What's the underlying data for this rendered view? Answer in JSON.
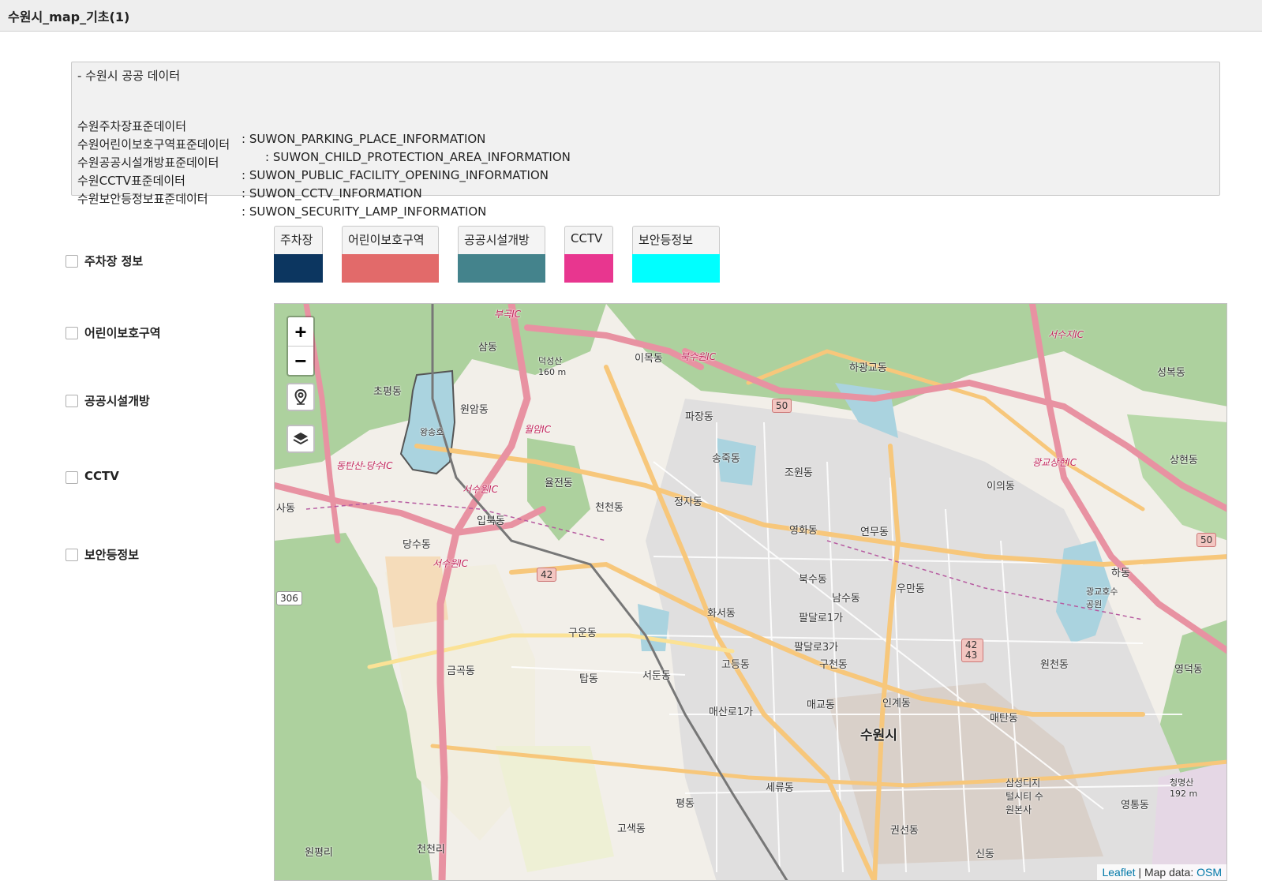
{
  "header": {
    "title": "수원시_map_기초(1)"
  },
  "info": {
    "heading": "- 수원시 공공 데이터",
    "rows": [
      {
        "name": "수원주차장표준데이터",
        "table": ": SUWON_PARKING_PLACE_INFORMATION"
      },
      {
        "name": "수원어린이보호구역표준데이터",
        "table": ": SUWON_CHILD_PROTECTION_AREA_INFORMATION"
      },
      {
        "name": "수원공공시설개방표준데이터",
        "table": ": SUWON_PUBLIC_FACILITY_OPENING_INFORMATION"
      },
      {
        "name": "수원CCTV표준데이터",
        "table": ": SUWON_CCTV_INFORMATION"
      },
      {
        "name": "수원보안등정보표준데이터",
        "table": ": SUWON_SECURITY_LAMP_INFORMATION"
      }
    ]
  },
  "layers": [
    {
      "label": "주차장 정보",
      "checked": false
    },
    {
      "label": "어린이보호구역",
      "checked": false
    },
    {
      "label": "공공시설개방",
      "checked": false
    },
    {
      "label": "CCTV",
      "checked": false
    },
    {
      "label": "보안등정보",
      "checked": false
    }
  ],
  "legend": [
    {
      "label": "주차장",
      "color": "#0c3660"
    },
    {
      "label": "어린이보호구역",
      "color": "#e26a6a"
    },
    {
      "label": "공공시설개방",
      "color": "#44838c"
    },
    {
      "label": "CCTV",
      "color": "#e8368f"
    },
    {
      "label": "보안등정보",
      "color": "#00ffff"
    }
  ],
  "map": {
    "zoom_in": "+",
    "zoom_out": "−",
    "locate_icon": "map-pin-icon",
    "layers_icon": "layers-icon",
    "labels": {
      "city": "수원시",
      "d1": "삼동",
      "d2": "이목동",
      "d3": "하광교동",
      "d4": "성복동",
      "d5": "초평동",
      "d6": "원암동",
      "d7": "파장동",
      "d8": "송죽동",
      "d9": "조원동",
      "d10": "상현동",
      "d11": "율전동",
      "d12": "천천동",
      "d13": "정자동",
      "d14": "이의동",
      "d15": "입북동",
      "d16": "영화동",
      "d17": "연무동",
      "d18": "당수동",
      "d19": "북수동",
      "d20": "하동",
      "d21": "남수동",
      "d22": "우만동",
      "d23": "화서동",
      "d24": "팔달로1가",
      "d25": "구운동",
      "d26": "팔달로3가",
      "d27": "고등동",
      "d28": "구천동",
      "d29": "원천동",
      "d30": "영덕동",
      "d31": "금곡동",
      "d32": "탑동",
      "d33": "서둔동",
      "d34": "매교동",
      "d35": "인계동",
      "d36": "매산로1가",
      "d37": "매탄동",
      "d38": "세류동",
      "d39": "평동",
      "d40": "고색동",
      "d41": "권선동",
      "d42": "영통동",
      "d43": "원평리",
      "d44": "천천리",
      "d45": "신동",
      "d46": "사동",
      "d47": "광교호수공원",
      "d48": "삼성디지털시티 수원본사",
      "d49": "청명산 192 m",
      "d50": "덕성산 160 m",
      "d51": "왕송호",
      "ic1": "부곡IC",
      "ic2": "북수원IC",
      "ic3": "서수지IC",
      "ic4": "동탄산-당수IC",
      "ic5": "서수원IC",
      "ic6": "서수원IC",
      "ic7": "광교상현IC",
      "ic8": "월암IC",
      "r50": "50",
      "r50b": "50",
      "r42": "42",
      "r4243": "42\n43",
      "r306": "306"
    },
    "attribution": {
      "leaflet": "Leaflet",
      "sep": " | Map data: ",
      "osm": "OSM"
    }
  }
}
